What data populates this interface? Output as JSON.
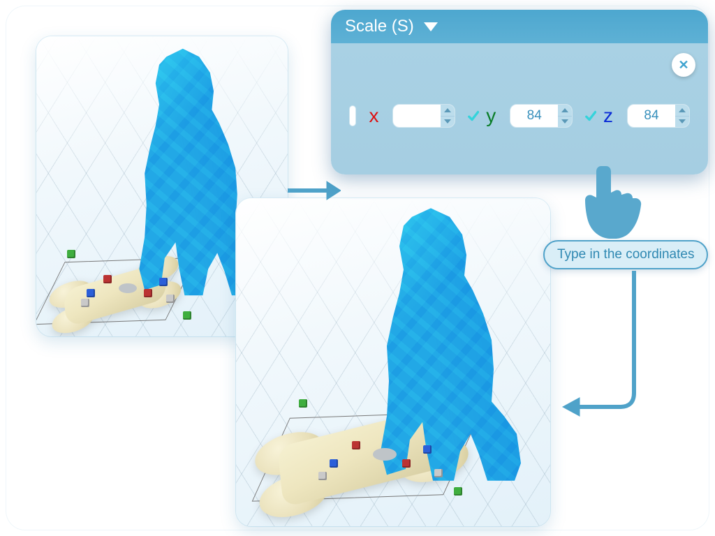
{
  "panel": {
    "title": "Scale (S)",
    "close_label": "close",
    "axes": {
      "x": {
        "label": "x",
        "checked": false,
        "value": ""
      },
      "y": {
        "label": "y",
        "checked": true,
        "value": "84"
      },
      "z": {
        "label": "z",
        "checked": true,
        "value": "84"
      }
    }
  },
  "tooltip": {
    "text": "Type in the coordinates"
  },
  "viewports": {
    "before": {
      "desc": "dog with small bone selected on grid"
    },
    "after": {
      "desc": "dog with enlarged bone on grid"
    }
  }
}
